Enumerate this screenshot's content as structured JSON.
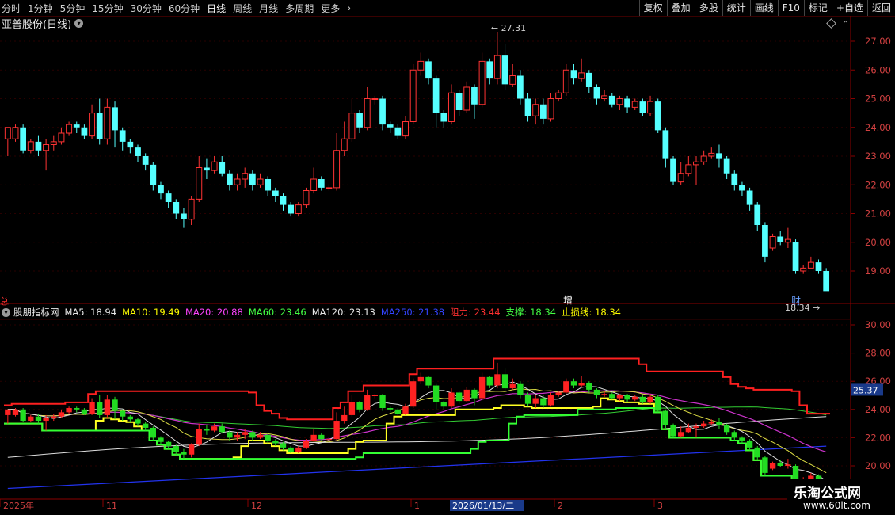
{
  "toolbar": {
    "periods": [
      "分时",
      "1分钟",
      "5分钟",
      "15分钟",
      "30分钟",
      "60分钟",
      "日线",
      "周线",
      "月线",
      "多周期",
      "更多"
    ],
    "active_period": "日线",
    "more_arrow": "›",
    "right_buttons": [
      "复权",
      "叠加",
      "多股",
      "统计",
      "画线",
      "F10",
      "标记",
      "+自选",
      "返回"
    ]
  },
  "stock": {
    "name": "亚普股份(日线)",
    "icon": "chevron-down-icon"
  },
  "price_axis": [
    "27.00",
    "26.00",
    "25.00",
    "24.00",
    "23.00",
    "22.00",
    "21.00",
    "20.00",
    "19.00"
  ],
  "markers": {
    "high_label": "27.31",
    "low_label": "18.34",
    "zeng": "增",
    "cai": "财",
    "left_mark": "总"
  },
  "indicator": {
    "name": "股朋指标网",
    "items": [
      {
        "label": "MA5: 18.94",
        "color": "#e8e8e8"
      },
      {
        "label": "MA10: 19.49",
        "color": "#ffff00"
      },
      {
        "label": "MA20: 20.88",
        "color": "#ff44ff"
      },
      {
        "label": "MA60: 23.46",
        "color": "#44ff44"
      },
      {
        "label": "MA120: 23.13",
        "color": "#e8e8e8"
      },
      {
        "label": "MA250: 21.38",
        "color": "#3344ff"
      },
      {
        "label": "阻力: 23.44",
        "color": "#ff3030"
      },
      {
        "label": "支撑: 18.34",
        "color": "#44ff44"
      },
      {
        "label": "止损线: 18.34",
        "color": "#ffff00"
      }
    ],
    "axis": [
      "30.00",
      "28.00",
      "26.00",
      "24.00",
      "22.00",
      "20.00"
    ],
    "current_tag": "25.37"
  },
  "date_axis": [
    "2025年",
    "11",
    "12",
    "1",
    "2",
    "3"
  ],
  "cursor_date": "2026/01/13/二",
  "watermark": {
    "line1": "乐淘公式网",
    "line2": "www.60lt.com"
  },
  "chart_data": {
    "type": "candlestick",
    "title": "亚普股份(日线)",
    "ylim": [
      18.0,
      27.6
    ],
    "candles": [
      [
        23.6,
        24.0,
        24.0,
        23.0
      ],
      [
        23.6,
        24.0,
        24.1,
        23.5
      ],
      [
        24.0,
        23.2,
        24.1,
        23.1
      ],
      [
        23.2,
        23.5,
        23.6,
        23.1
      ],
      [
        23.5,
        23.2,
        23.7,
        23.0
      ],
      [
        23.2,
        23.4,
        23.6,
        22.5
      ],
      [
        23.4,
        23.5,
        23.7,
        23.2
      ],
      [
        23.5,
        23.8,
        24.0,
        23.4
      ],
      [
        23.8,
        24.1,
        24.2,
        23.7
      ],
      [
        24.1,
        24.0,
        24.2,
        23.8
      ],
      [
        24.0,
        23.7,
        24.1,
        23.6
      ],
      [
        23.7,
        24.5,
        24.8,
        23.6
      ],
      [
        24.5,
        23.6,
        25.0,
        23.4
      ],
      [
        23.6,
        24.7,
        25.0,
        23.4
      ],
      [
        24.7,
        23.9,
        24.9,
        23.3
      ],
      [
        23.9,
        23.5,
        24.0,
        23.2
      ],
      [
        23.5,
        23.3,
        23.6,
        23.1
      ],
      [
        23.3,
        23.0,
        23.4,
        22.8
      ],
      [
        23.0,
        22.7,
        23.1,
        22.5
      ],
      [
        22.7,
        22.0,
        22.8,
        21.8
      ],
      [
        22.0,
        21.7,
        22.1,
        21.5
      ],
      [
        21.7,
        21.4,
        21.8,
        21.2
      ],
      [
        21.4,
        21.0,
        21.5,
        20.8
      ],
      [
        21.0,
        20.8,
        21.2,
        20.5
      ],
      [
        20.8,
        21.5,
        21.6,
        20.6
      ],
      [
        21.5,
        22.6,
        23.0,
        21.4
      ],
      [
        22.6,
        22.5,
        22.9,
        22.2
      ],
      [
        22.5,
        22.8,
        23.0,
        22.4
      ],
      [
        22.8,
        22.4,
        23.0,
        22.3
      ],
      [
        22.4,
        22.0,
        22.5,
        21.8
      ],
      [
        22.0,
        22.2,
        22.4,
        21.8
      ],
      [
        22.2,
        22.4,
        22.6,
        21.9
      ],
      [
        22.4,
        22.0,
        22.5,
        21.8
      ],
      [
        22.0,
        22.2,
        22.4,
        21.9
      ],
      [
        22.2,
        21.8,
        22.3,
        21.6
      ],
      [
        21.8,
        21.6,
        21.9,
        21.4
      ],
      [
        21.6,
        21.3,
        21.7,
        21.1
      ],
      [
        21.3,
        21.0,
        21.4,
        20.9
      ],
      [
        21.0,
        21.3,
        21.4,
        20.9
      ],
      [
        21.3,
        21.8,
        21.9,
        21.2
      ],
      [
        21.8,
        22.2,
        22.6,
        21.7
      ],
      [
        22.2,
        21.9,
        22.3,
        21.8
      ],
      [
        21.9,
        21.9,
        22.0,
        21.8
      ],
      [
        21.9,
        23.2,
        23.8,
        21.8
      ],
      [
        23.2,
        23.6,
        24.2,
        23.0
      ],
      [
        23.6,
        24.5,
        25.0,
        23.5
      ],
      [
        24.5,
        24.0,
        24.6,
        23.8
      ],
      [
        24.0,
        25.0,
        25.4,
        23.9
      ],
      [
        25.0,
        25.0,
        25.1,
        24.8
      ],
      [
        25.0,
        24.1,
        25.1,
        23.9
      ],
      [
        24.1,
        24.0,
        24.2,
        23.8
      ],
      [
        24.0,
        23.7,
        24.1,
        23.6
      ],
      [
        23.7,
        24.2,
        24.4,
        23.6
      ],
      [
        24.2,
        26.0,
        26.2,
        24.1
      ],
      [
        26.0,
        26.3,
        26.6,
        25.8
      ],
      [
        26.3,
        25.7,
        26.4,
        25.5
      ],
      [
        25.7,
        24.5,
        25.8,
        24.0
      ],
      [
        24.5,
        24.2,
        24.6,
        24.0
      ],
      [
        24.2,
        25.2,
        25.5,
        24.1
      ],
      [
        25.2,
        24.6,
        25.3,
        24.4
      ],
      [
        24.6,
        25.4,
        25.6,
        24.5
      ],
      [
        25.4,
        24.8,
        25.5,
        24.3
      ],
      [
        24.8,
        26.3,
        26.6,
        24.7
      ],
      [
        26.3,
        25.7,
        26.4,
        25.5
      ],
      [
        25.7,
        26.5,
        27.31,
        25.5
      ],
      [
        26.5,
        25.5,
        26.9,
        25.3
      ],
      [
        25.5,
        25.8,
        26.2,
        25.4
      ],
      [
        25.8,
        25.0,
        26.0,
        24.8
      ],
      [
        25.0,
        24.4,
        25.2,
        24.2
      ],
      [
        24.4,
        24.8,
        25.0,
        24.1
      ],
      [
        24.8,
        24.3,
        25.0,
        24.1
      ],
      [
        24.3,
        25.0,
        25.2,
        24.2
      ],
      [
        25.0,
        25.2,
        25.3,
        24.9
      ],
      [
        25.2,
        26.0,
        26.2,
        25.1
      ],
      [
        26.0,
        25.7,
        26.2,
        25.5
      ],
      [
        25.7,
        25.9,
        26.4,
        25.6
      ],
      [
        25.9,
        25.4,
        26.0,
        25.2
      ],
      [
        25.4,
        25.0,
        25.5,
        24.8
      ],
      [
        25.0,
        25.1,
        25.3,
        24.9
      ],
      [
        25.1,
        24.8,
        25.2,
        24.7
      ],
      [
        24.8,
        25.0,
        25.1,
        24.6
      ],
      [
        25.0,
        24.7,
        25.1,
        24.5
      ],
      [
        24.7,
        24.9,
        25.0,
        24.6
      ],
      [
        24.9,
        24.5,
        25.0,
        24.4
      ],
      [
        24.5,
        24.9,
        25.1,
        24.4
      ],
      [
        24.9,
        23.9,
        25.0,
        23.8
      ],
      [
        23.9,
        22.9,
        24.0,
        22.6
      ],
      [
        22.9,
        22.1,
        23.0,
        22.0
      ],
      [
        22.1,
        22.4,
        22.8,
        22.0
      ],
      [
        22.4,
        22.7,
        23.0,
        22.3
      ],
      [
        22.7,
        22.8,
        23.0,
        22.0
      ],
      [
        22.8,
        23.0,
        23.2,
        22.7
      ],
      [
        23.0,
        23.1,
        23.3,
        22.9
      ],
      [
        23.1,
        22.9,
        23.4,
        22.6
      ],
      [
        22.9,
        22.4,
        23.0,
        22.2
      ],
      [
        22.4,
        22.0,
        22.5,
        21.8
      ],
      [
        22.0,
        21.8,
        22.1,
        21.6
      ],
      [
        21.8,
        21.3,
        21.9,
        21.1
      ],
      [
        21.3,
        20.6,
        21.4,
        20.4
      ],
      [
        20.6,
        19.5,
        20.7,
        19.3
      ],
      [
        19.8,
        20.2,
        20.3,
        19.7
      ],
      [
        20.2,
        20.0,
        20.4,
        19.9
      ],
      [
        20.0,
        20.1,
        20.5,
        19.8
      ],
      [
        20.0,
        19.0,
        20.1,
        18.9
      ],
      [
        19.0,
        19.1,
        19.2,
        18.9
      ],
      [
        19.1,
        19.3,
        19.5,
        19.1
      ],
      [
        19.3,
        19.0,
        19.4,
        18.9
      ],
      [
        19.0,
        18.3,
        19.1,
        18.34
      ]
    ]
  }
}
